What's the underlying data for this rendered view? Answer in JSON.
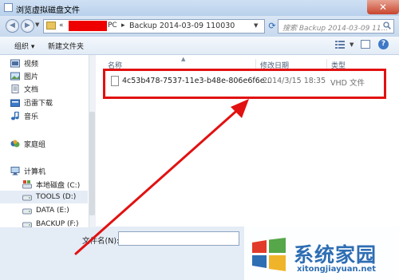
{
  "window": {
    "title": "浏览虚拟磁盘文件",
    "close_label": "✕"
  },
  "address": {
    "chevron": "«",
    "pc_label": "PC",
    "separator": "▸",
    "crumb": "Backup 2014-03-09 110030",
    "dropdown": "▼",
    "refresh": "⟳"
  },
  "search": {
    "placeholder": "搜索 Backup 2014-03-09 11..."
  },
  "toolbar": {
    "organize_label": "组织 ▾",
    "new_folder_label": "新建文件夹",
    "view_dropdown": "▼",
    "help_label": "?"
  },
  "sidebar": {
    "items": [
      {
        "label": "视频",
        "icon": "video-library-icon"
      },
      {
        "label": "图片",
        "icon": "pictures-library-icon"
      },
      {
        "label": "文档",
        "icon": "documents-library-icon"
      },
      {
        "label": "迅雷下载",
        "icon": "download-folder-icon"
      },
      {
        "label": "音乐",
        "icon": "music-library-icon"
      },
      {
        "label": "家庭组",
        "icon": "homegroup-icon"
      },
      {
        "label": "计算机",
        "icon": "computer-icon"
      },
      {
        "label": "本地磁盘 (C:)",
        "icon": "system-drive-icon"
      },
      {
        "label": "TOOLS (D:)",
        "icon": "drive-icon"
      },
      {
        "label": "DATA (E:)",
        "icon": "drive-icon"
      },
      {
        "label": "BACKUP (F:)",
        "icon": "drive-icon"
      }
    ]
  },
  "columns": {
    "name": "名称",
    "date": "修改日期",
    "type": "类型"
  },
  "files": [
    {
      "name": "4c53b478-7537-11e3-b48e-806e6f6e...",
      "date": "2014/3/15 18:35",
      "type": "VHD 文件"
    }
  ],
  "footer": {
    "filename_label": "文件名(N):",
    "filename_value": ""
  },
  "watermark": {
    "text": "系统家园",
    "url": "xitongjiayuan.net"
  },
  "colors": {
    "highlight": "#e21111",
    "arrow": "#e21111",
    "watermark": "#2e6eb3"
  }
}
